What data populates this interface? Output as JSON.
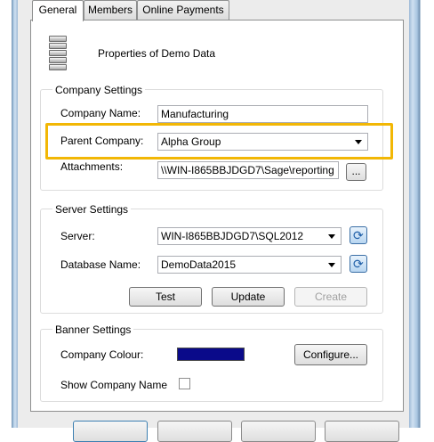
{
  "tabs": [
    {
      "label": "General",
      "active": true
    },
    {
      "label": "Members",
      "active": false
    },
    {
      "label": "Online Payments",
      "active": false
    }
  ],
  "header": {
    "title": "Properties of Demo Data",
    "icon": "database-icon"
  },
  "company_settings": {
    "title": "Company Settings",
    "company_name_label": "Company Name:",
    "company_name_value": "Manufacturing",
    "parent_company_label": "Parent Company:",
    "parent_company_value": "Alpha Group",
    "attachments_label": "Attachments:",
    "attachments_value": "\\\\WIN-I865BBJDGD7\\Sage\\reporting",
    "browse_label": "..."
  },
  "server_settings": {
    "title": "Server Settings",
    "server_label": "Server:",
    "server_value": "WIN-I865BBJDGD7\\SQL2012",
    "database_label": "Database Name:",
    "database_value": "DemoData2015",
    "test_label": "Test",
    "update_label": "Update",
    "create_label": "Create"
  },
  "banner_settings": {
    "title": "Banner Settings",
    "colour_label": "Company Colour:",
    "colour_value": "#0a0a8a",
    "configure_label": "Configure...",
    "show_name_label": "Show Company Name",
    "show_name_checked": false
  },
  "colors": {
    "highlight": "#f2b705",
    "window_frame": "#a9c5e0"
  }
}
